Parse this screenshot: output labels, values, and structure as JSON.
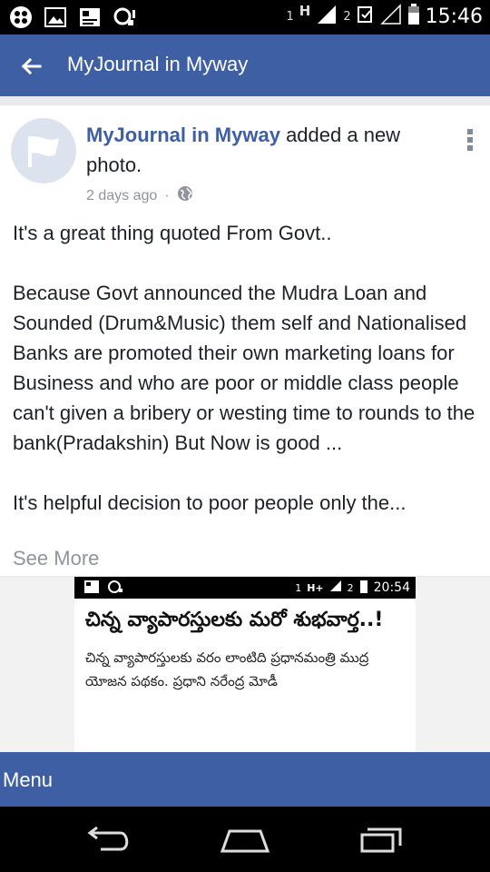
{
  "status_bar": {
    "time": "15:46",
    "sim1_label": "1",
    "network_type": "H",
    "sim2_label": "2",
    "icons": [
      "blackberry-icon",
      "image-icon",
      "photo-icon",
      "signal-alert-icon",
      "signal-icon",
      "signal-icon",
      "battery-icon"
    ]
  },
  "app_bar": {
    "title": "MyJournal in Myway",
    "back_icon": "back-arrow-icon"
  },
  "post": {
    "author": "MyJournal in Myway",
    "action": " added a new photo.",
    "time": "2 days ago",
    "separator": "·",
    "privacy_icon": "globe-icon",
    "text": "It's a great thing quoted From Govt..\n\nBecause Govt announced the Mudra Loan and Sounded (Drum&Music) them self and Nationalised Banks are  promoted their own marketing loans for Business and who are poor or middle class people can't given a bribery or westing time to rounds to the bank(Pradakshin)  But Now is good ...\n\nIt's helpful decision to poor people only the...",
    "see_more": "See More"
  },
  "photo": {
    "status_time": "20:54",
    "status_sim1": "1",
    "status_network": "H+",
    "status_sim2": "2",
    "headline": "చిన్న వ్యాపారస్తులకు మరో శుభవార్త..!",
    "body": "చిన్న వ్యాపారస్తులకు వరం లాంటిది ప్రధానమంత్రి ముద్ర యోజన పథకం. ప్రధాని నరేంద్ర మోడీ"
  },
  "menu_bar": {
    "label": "Menu"
  },
  "nav_bar": {
    "icons": [
      "back-nav-icon",
      "home-nav-icon",
      "recent-apps-icon"
    ]
  },
  "colors": {
    "brand_blue": "#3f5fa4",
    "meta_gray": "#90949c",
    "text": "#1d2129"
  }
}
